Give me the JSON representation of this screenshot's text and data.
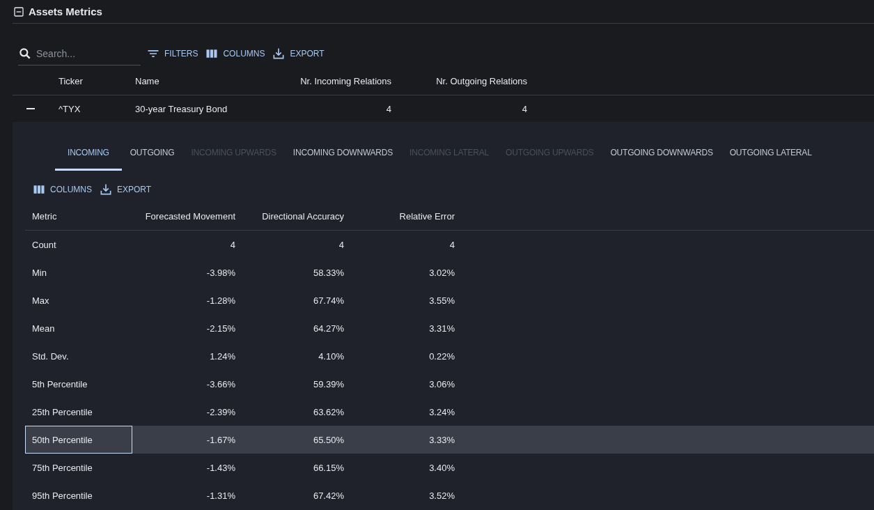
{
  "section": {
    "title": "Assets Metrics",
    "expanded": true
  },
  "search": {
    "placeholder": "Search..."
  },
  "toolbar": [
    {
      "kind": "filter",
      "label": "FILTERS"
    },
    {
      "kind": "columns",
      "label": "COLUMNS"
    },
    {
      "kind": "export",
      "label": "EXPORT"
    }
  ],
  "table": {
    "columns": [
      "Ticker",
      "Name",
      "Nr. Incoming Relations",
      "Nr. Outgoing Relations"
    ],
    "rows": [
      {
        "expanded": true,
        "cells": [
          "^TYX",
          "30-year Treasury Bond",
          "4",
          "4"
        ]
      }
    ]
  },
  "detail": {
    "tabs": [
      {
        "label": "INCOMING",
        "selected": true,
        "disabled": false
      },
      {
        "label": "OUTGOING",
        "selected": false,
        "disabled": false
      },
      {
        "label": "INCOMING UPWARDS",
        "selected": false,
        "disabled": true
      },
      {
        "label": "INCOMING DOWNWARDS",
        "selected": false,
        "disabled": false
      },
      {
        "label": "INCOMING LATERAL",
        "selected": false,
        "disabled": true
      },
      {
        "label": "OUTGOING UPWARDS",
        "selected": false,
        "disabled": true
      },
      {
        "label": "OUTGOING DOWNWARDS",
        "selected": false,
        "disabled": false
      },
      {
        "label": "OUTGOING LATERAL",
        "selected": false,
        "disabled": false
      }
    ],
    "toolbar": [
      {
        "kind": "columns",
        "label": "COLUMNS"
      },
      {
        "kind": "export",
        "label": "EXPORT"
      }
    ],
    "table": {
      "columns": [
        "Metric",
        "Forecasted Movement",
        "Directional Accuracy",
        "Relative Error"
      ],
      "rows": [
        {
          "selected": false,
          "focused": false,
          "cells": [
            "Count",
            "4",
            "4",
            "4"
          ]
        },
        {
          "selected": false,
          "focused": false,
          "cells": [
            "Min",
            "-3.98%",
            "58.33%",
            "3.02%"
          ]
        },
        {
          "selected": false,
          "focused": false,
          "cells": [
            "Max",
            "-1.28%",
            "67.74%",
            "3.55%"
          ]
        },
        {
          "selected": false,
          "focused": false,
          "cells": [
            "Mean",
            "-2.15%",
            "64.27%",
            "3.31%"
          ]
        },
        {
          "selected": false,
          "focused": false,
          "cells": [
            "Std. Dev.",
            "1.24%",
            "4.10%",
            "0.22%"
          ]
        },
        {
          "selected": false,
          "focused": false,
          "cells": [
            "5th Percentile",
            "-3.66%",
            "59.39%",
            "3.06%"
          ]
        },
        {
          "selected": false,
          "focused": false,
          "cells": [
            "25th Percentile",
            "-2.39%",
            "63.62%",
            "3.24%"
          ]
        },
        {
          "selected": true,
          "focused": true,
          "cells": [
            "50th Percentile",
            "-1.67%",
            "65.50%",
            "3.33%"
          ]
        },
        {
          "selected": false,
          "focused": false,
          "cells": [
            "75th Percentile",
            "-1.43%",
            "66.15%",
            "3.40%"
          ]
        },
        {
          "selected": false,
          "focused": false,
          "cells": [
            "95th Percentile",
            "-1.31%",
            "67.42%",
            "3.52%"
          ]
        }
      ]
    }
  }
}
